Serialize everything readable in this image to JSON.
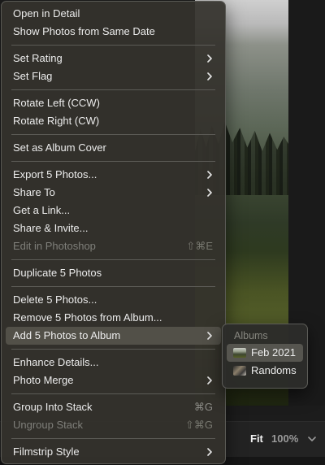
{
  "context_menu": {
    "items": [
      {
        "label": "Open in Detail"
      },
      {
        "label": "Show Photos from Same Date"
      },
      {
        "label": "Set Rating"
      },
      {
        "label": "Set Flag"
      },
      {
        "label": "Rotate Left (CCW)"
      },
      {
        "label": "Rotate Right (CW)"
      },
      {
        "label": "Set as Album Cover"
      },
      {
        "label": "Export 5 Photos..."
      },
      {
        "label": "Share To"
      },
      {
        "label": "Get a Link..."
      },
      {
        "label": "Share & Invite..."
      },
      {
        "label": "Edit in Photoshop",
        "shortcut": "⇧⌘E"
      },
      {
        "label": "Duplicate 5 Photos"
      },
      {
        "label": "Delete 5 Photos..."
      },
      {
        "label": "Remove 5 Photos from Album..."
      },
      {
        "label": "Add 5 Photos to Album"
      },
      {
        "label": "Enhance Details..."
      },
      {
        "label": "Photo Merge"
      },
      {
        "label": "Group Into Stack",
        "shortcut": "⌘G"
      },
      {
        "label": "Ungroup Stack",
        "shortcut": "⇧⌘G"
      },
      {
        "label": "Filmstrip Style"
      }
    ]
  },
  "albums_submenu": {
    "header": "Albums",
    "items": [
      {
        "label": "Feb 2021"
      },
      {
        "label": "Randoms"
      }
    ]
  },
  "zoom": {
    "fit_label": "Fit",
    "percent": "100%"
  },
  "colors": {
    "menu_bg": "#34322c",
    "highlight": "#525048",
    "text": "#ececec",
    "disabled_text": "#7f7f7a"
  }
}
